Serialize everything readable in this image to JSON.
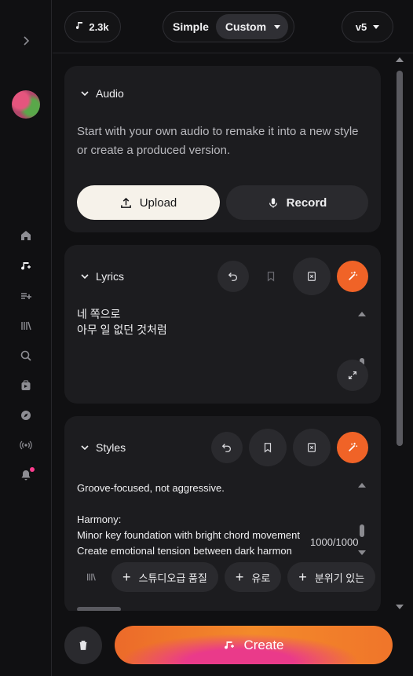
{
  "topbar": {
    "credits": "2.3k",
    "mode_simple": "Simple",
    "mode_custom": "Custom",
    "version": "v5"
  },
  "sidebar": {
    "items": [
      "expand-icon",
      "home-icon",
      "create-icon",
      "add-queue-icon",
      "library-icon",
      "search-icon",
      "studio-icon",
      "explore-icon",
      "radio-icon",
      "bell-icon"
    ]
  },
  "audio": {
    "title": "Audio",
    "description": "Start with your own audio to remake it into a new style or create a produced version.",
    "upload_label": "Upload",
    "record_label": "Record"
  },
  "lyrics": {
    "title": "Lyrics",
    "text": "네 쪽으로\n아무 일 없던 것처럼"
  },
  "styles": {
    "title": "Styles",
    "text": "Groove-focused, not aggressive.\n\nHarmony:\nMinor key foundation with bright chord movement\nCreate emotional tension between dark harmon",
    "char_count": "1000/1000",
    "tags": [
      "스튜디오급 품질",
      "유로",
      "분위기 있는"
    ]
  },
  "bottom": {
    "create_label": "Create"
  },
  "colors": {
    "accent": "#f06327",
    "background": "#101012",
    "card": "#1c1c1f"
  }
}
